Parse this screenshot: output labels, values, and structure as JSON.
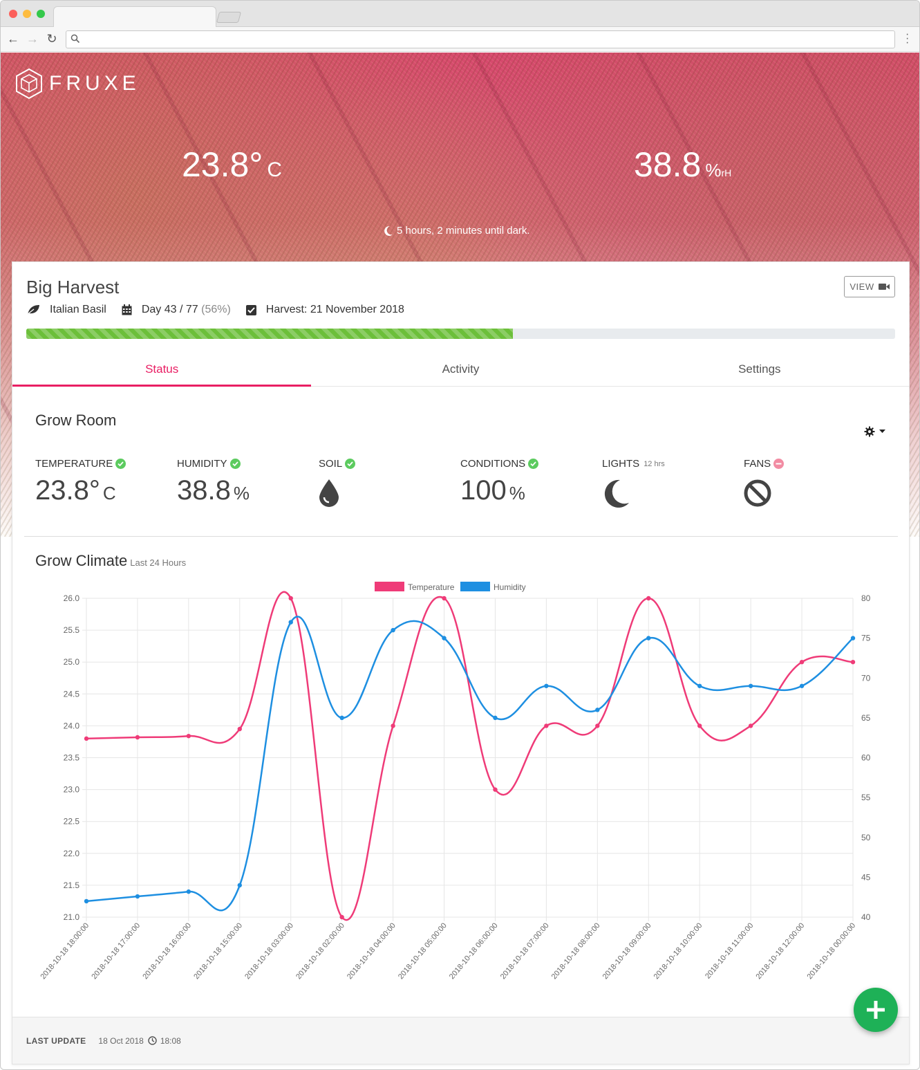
{
  "hero": {
    "logo_text": "FRUXE",
    "temp_value": "23.8°",
    "temp_unit": "C",
    "hum_value": "38.8",
    "hum_unit": "%",
    "hum_unit_suffix": "rH",
    "dark_text": "5 hours, 2 minutes until dark."
  },
  "card": {
    "title": "Big Harvest",
    "view_label": "VIEW",
    "crop": "Italian Basil",
    "day_text": "Day 43 / 77",
    "day_percent": "(56%)",
    "harvest_text": "Harvest: 21 November 2018",
    "progress": 0.56
  },
  "tabs": [
    "Status",
    "Activity",
    "Settings"
  ],
  "grow_room": {
    "title": "Grow Room",
    "stats": [
      {
        "label": "TEMPERATURE",
        "value": "23.8°",
        "unit": "C",
        "status": "ok"
      },
      {
        "label": "HUMIDITY",
        "value": "38.8",
        "unit": "%",
        "status": "ok"
      },
      {
        "label": "SOIL",
        "icon": "water-drop-icon",
        "status": "ok"
      },
      {
        "label": "CONDITIONS",
        "value": "100",
        "unit": "%",
        "status": "ok"
      },
      {
        "label": "LIGHTS",
        "note": "12 hrs",
        "icon": "moon-icon"
      },
      {
        "label": "FANS",
        "icon": "ban-icon",
        "status": "off"
      }
    ]
  },
  "climate": {
    "title": "Grow Climate",
    "subtitle": "Last 24 Hours"
  },
  "chart_data": {
    "type": "line",
    "categories": [
      "2018-10-18 18:00:00",
      "2018-10-18 17:00:00",
      "2018-10-18 16:00:00",
      "2018-10-18 15:00:00",
      "2018-10-18 03:00:00",
      "2018-10-18 02:00:00",
      "2018-10-18 04:00:00",
      "2018-10-18 05:00:00",
      "2018-10-18 06:00:00",
      "2018-10-18 07:00:00",
      "2018-10-18 08:00:00",
      "2018-10-18 09:00:00",
      "2018-10-18 10:00:00",
      "2018-10-18 11:00:00",
      "2018-10-18 12:00:00",
      "2018-10-18 00:00:00"
    ],
    "series": [
      {
        "name": "Temperature",
        "axis": "left",
        "color": "#ef3b78",
        "values": [
          23.8,
          23.82,
          23.84,
          23.95,
          26.0,
          21.0,
          24.0,
          26.0,
          23.0,
          24.0,
          24.0,
          26.0,
          24.0,
          24.0,
          25.0,
          25.0
        ]
      },
      {
        "name": "Humidity",
        "axis": "right",
        "color": "#1e8fe1",
        "values": [
          42,
          42.6,
          43.2,
          44,
          77,
          65,
          76,
          75,
          65,
          69,
          66,
          75,
          69,
          69,
          69,
          75
        ]
      }
    ],
    "y_left": {
      "min": 21.0,
      "max": 26.0,
      "ticks": [
        "26.0",
        "25.5",
        "25.0",
        "24.5",
        "24.0",
        "23.5",
        "23.0",
        "22.5",
        "22.0",
        "21.5",
        "21.0"
      ]
    },
    "y_right": {
      "min": 40,
      "max": 80,
      "ticks": [
        "80",
        "75",
        "70",
        "65",
        "60",
        "55",
        "50",
        "45",
        "40"
      ]
    },
    "legend_position": "top",
    "grid": true
  },
  "footer": {
    "label": "LAST UPDATE",
    "date": "18 Oct 2018",
    "time": "18:08"
  },
  "colors": {
    "accent": "#e91e63",
    "progress": "#6cbf3a",
    "ok": "#5ccb5f",
    "off": "#f28ca3",
    "fab": "#1eb157"
  }
}
